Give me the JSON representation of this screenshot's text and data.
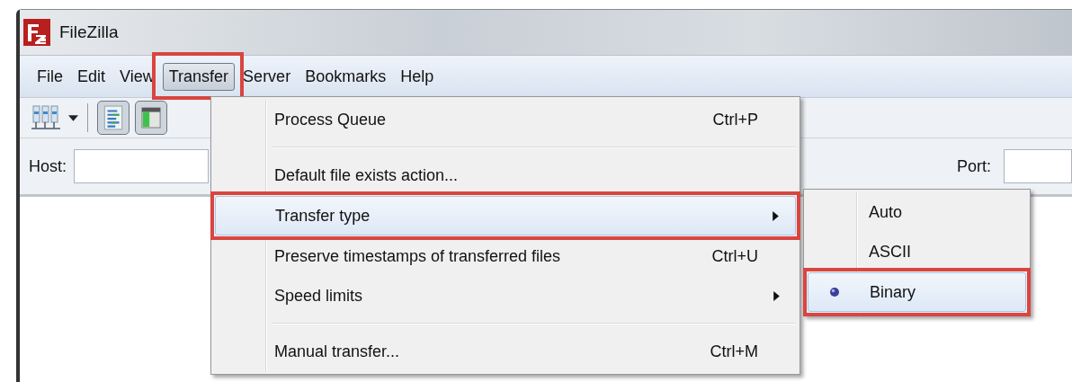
{
  "window": {
    "title": "FileZilla"
  },
  "menu_bar": [
    {
      "label": "File",
      "selected": false,
      "highlighted": false
    },
    {
      "label": "Edit",
      "selected": false,
      "highlighted": false
    },
    {
      "label": "View",
      "selected": false,
      "highlighted": false
    },
    {
      "label": "Transfer",
      "selected": true,
      "highlighted": true
    },
    {
      "label": "Server",
      "selected": false,
      "highlighted": false
    },
    {
      "label": "Bookmarks",
      "selected": false,
      "highlighted": false
    },
    {
      "label": "Help",
      "selected": false,
      "highlighted": false
    }
  ],
  "quickconnect": {
    "host_label": "Host:",
    "port_label": "Port:"
  },
  "transfer_menu": {
    "items": [
      {
        "kind": "item",
        "label": "Process Queue",
        "shortcut": "Ctrl+P",
        "selected": false,
        "highlighted": false
      },
      {
        "kind": "separator"
      },
      {
        "kind": "item",
        "label": "Default file exists action...",
        "selected": false,
        "highlighted": false
      },
      {
        "kind": "submenu",
        "label": "Transfer type",
        "selected": true,
        "highlighted": true
      },
      {
        "kind": "item",
        "label": "Preserve timestamps of transferred files",
        "shortcut": "Ctrl+U",
        "selected": false,
        "highlighted": false
      },
      {
        "kind": "submenu",
        "label": "Speed limits",
        "selected": false,
        "highlighted": false
      },
      {
        "kind": "separator"
      },
      {
        "kind": "item",
        "label": "Manual transfer...",
        "shortcut": "Ctrl+M",
        "selected": false,
        "highlighted": false
      }
    ]
  },
  "transfer_type_menu": {
    "items": [
      {
        "label": "Auto",
        "checked": false,
        "selected": false,
        "highlighted": false
      },
      {
        "label": "ASCII",
        "checked": false,
        "selected": false,
        "highlighted": false
      },
      {
        "label": "Binary",
        "checked": true,
        "selected": true,
        "highlighted": true
      }
    ]
  }
}
